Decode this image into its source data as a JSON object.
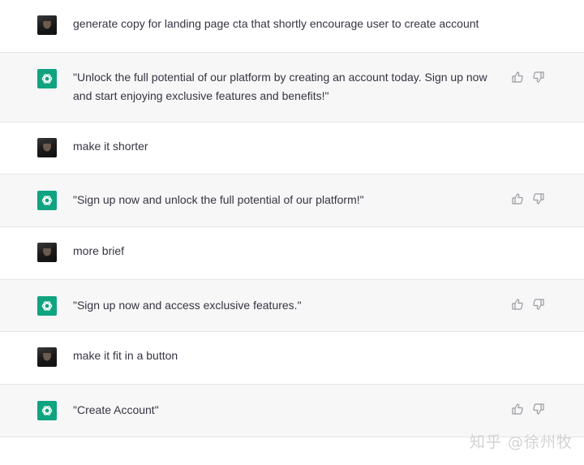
{
  "conversation": {
    "messages": [
      {
        "role": "user",
        "text": "generate copy for landing page cta that shortly encourage user to create account"
      },
      {
        "role": "assistant",
        "text": "\"Unlock the full potential of our platform by creating an account today. Sign up now and start enjoying exclusive features and benefits!\""
      },
      {
        "role": "user",
        "text": "make it shorter"
      },
      {
        "role": "assistant",
        "text": "\"Sign up now and unlock the full potential of our platform!\""
      },
      {
        "role": "user",
        "text": "more brief"
      },
      {
        "role": "assistant",
        "text": "\"Sign up now and access exclusive features.\""
      },
      {
        "role": "user",
        "text": "make it fit in a button"
      },
      {
        "role": "assistant",
        "text": "\"Create Account\""
      }
    ]
  },
  "watermark": "知乎 @徐州牧",
  "icons": {
    "user_avatar": "user-photo-avatar",
    "assistant_avatar": "openai-logo-icon",
    "thumbs_up": "thumbs-up-icon",
    "thumbs_down": "thumbs-down-icon"
  },
  "colors": {
    "assistant_bg": "#f7f7f8",
    "user_bg": "#ffffff",
    "brand_green": "#10a37f",
    "text": "#343541"
  }
}
